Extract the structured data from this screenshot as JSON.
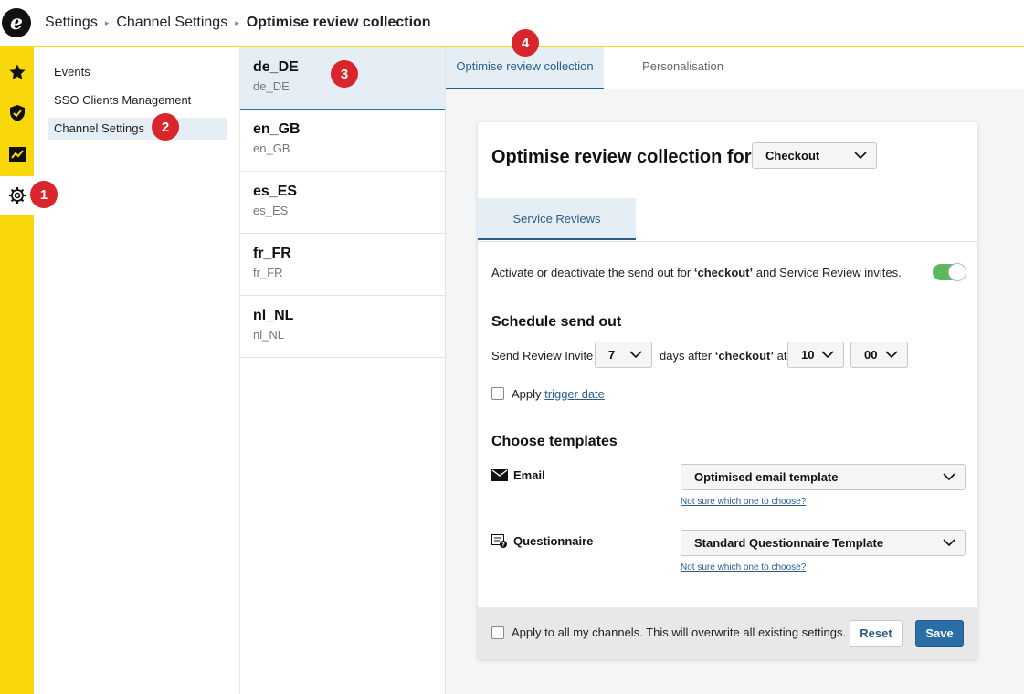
{
  "header": {
    "logo_letter": "e",
    "breadcrumbs": [
      "Settings",
      "Channel Settings",
      "Optimise review collection"
    ],
    "separator": "▸"
  },
  "rail": {
    "icons": [
      "star-icon",
      "shield-check-icon",
      "chart-icon",
      "gear-icon"
    ],
    "active": "gear-icon"
  },
  "nav": {
    "items": [
      "Events",
      "SSO Clients Management",
      "Channel Settings"
    ],
    "active": "Channel Settings"
  },
  "locales": [
    {
      "code": "de_DE",
      "sub": "de_DE",
      "active": true
    },
    {
      "code": "en_GB",
      "sub": "en_GB"
    },
    {
      "code": "es_ES",
      "sub": "es_ES"
    },
    {
      "code": "fr_FR",
      "sub": "fr_FR"
    },
    {
      "code": "nl_NL",
      "sub": "nl_NL"
    }
  ],
  "tabs": [
    {
      "label": "Optimise review collection",
      "active": true
    },
    {
      "label": "Personalisation"
    }
  ],
  "card": {
    "title": "Optimise review collection for:",
    "trigger_select": "Checkout",
    "subtab": "Service Reviews",
    "activate_text_1": "Activate or deactivate the send out for ",
    "activate_bold": "‘checkout’",
    "activate_text_2": " and Service Review invites.",
    "toggle_on": true,
    "schedule_heading": "Schedule send out",
    "send_label": "Send Review Invite",
    "days_value": "7",
    "days_after_text": "days after ",
    "days_after_bold": "‘checkout’",
    "at_text": " at",
    "hour_value": "10",
    "minute_value": "00",
    "apply_label": "Apply ",
    "apply_link": "trigger date",
    "templates_heading": "Choose templates",
    "email_label": "Email",
    "email_template": "Optimised email template",
    "questionnaire_label": "Questionnaire",
    "questionnaire_template": "Standard Questionnaire Template",
    "help_link": "Not sure which one to choose?",
    "footer_apply": "Apply to all my channels. This will overwrite all existing settings.",
    "reset_label": "Reset",
    "save_label": "Save"
  },
  "badges": [
    "1",
    "2",
    "3",
    "4"
  ],
  "colors": {
    "rail": "#f9d80b",
    "accent": "#2a5d8c",
    "active_bg": "#e4eef4",
    "toggle_on": "#5cb85c",
    "badge": "#d9262c",
    "save_button": "#2a6ea8"
  }
}
